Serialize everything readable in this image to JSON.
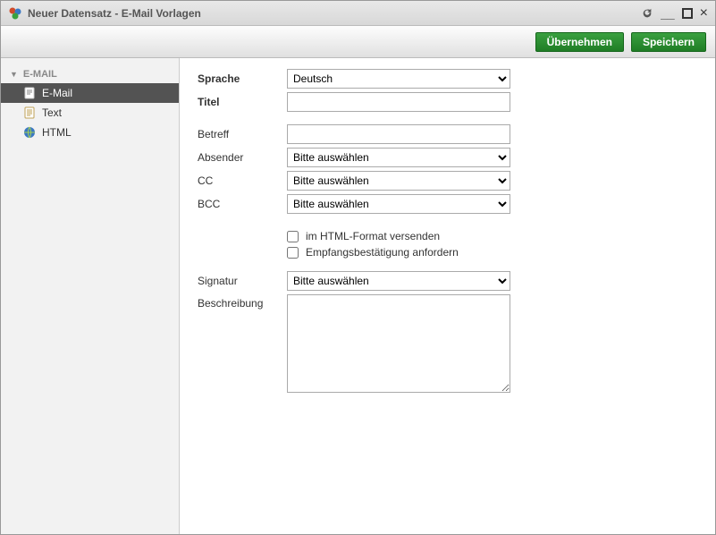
{
  "window": {
    "title": "Neuer Datensatz - E-Mail Vorlagen"
  },
  "toolbar": {
    "apply": "Übernehmen",
    "save": "Speichern"
  },
  "sidebar": {
    "header": "E-MAIL",
    "items": [
      {
        "label": "E-Mail"
      },
      {
        "label": "Text"
      },
      {
        "label": "HTML"
      }
    ]
  },
  "form": {
    "labels": {
      "language": "Sprache",
      "title": "Titel",
      "subject": "Betreff",
      "sender": "Absender",
      "cc": "CC",
      "bcc": "BCC",
      "signature": "Signatur",
      "description": "Beschreibung"
    },
    "values": {
      "language": "Deutsch",
      "title": "",
      "subject": "",
      "sender": "Bitte auswählen",
      "cc": "Bitte auswählen",
      "bcc": "Bitte auswählen",
      "signature": "Bitte auswählen",
      "description": ""
    },
    "options": {
      "please_select": "Bitte auswählen",
      "language_default": "Deutsch"
    },
    "checkboxes": {
      "html_format": {
        "label": "im HTML-Format versenden",
        "checked": false
      },
      "read_receipt": {
        "label": "Empfangsbestätigung anfordern",
        "checked": false
      }
    }
  }
}
